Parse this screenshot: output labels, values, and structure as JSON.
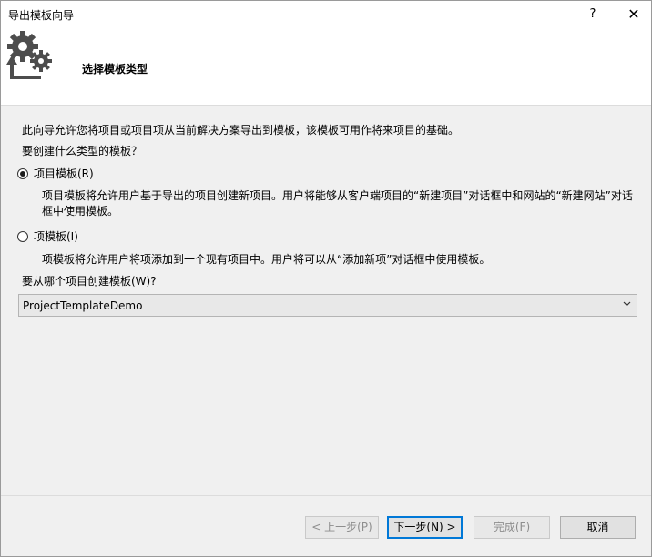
{
  "window": {
    "title": "导出模板向导",
    "help_label": "?",
    "close_label": "✕"
  },
  "header": {
    "title": "选择模板类型",
    "icon": "gears-export-icon"
  },
  "body": {
    "description": "此向导允许您将项目或项目项从当前解决方案导出到模板，该模板可用作将来项目的基础。",
    "question": "要创建什么类型的模板？",
    "options": [
      {
        "label": "项目模板(R)",
        "checked": true,
        "description": "项目模板将允许用户基于导出的项目创建新项目。用户将能够从客户端项目的“新建项目”对话框中和网站的“新建网站”对话框中使用模板。"
      },
      {
        "label": "项模板(I)",
        "checked": false,
        "description": "项模板将允许用户将项添加到一个现有项目中。用户将可以从“添加新项”对话框中使用模板。"
      }
    ],
    "source_label": "要从哪个项目创建模板(W)?",
    "source_value": "ProjectTemplateDemo"
  },
  "footer": {
    "prev": "< 上一步(P)",
    "next": "下一步(N) >",
    "finish": "完成(F)",
    "cancel": "取消"
  },
  "colors": {
    "accent": "#0078d7",
    "header_bg": "#ffffff",
    "dialog_bg": "#f0f0f0"
  }
}
